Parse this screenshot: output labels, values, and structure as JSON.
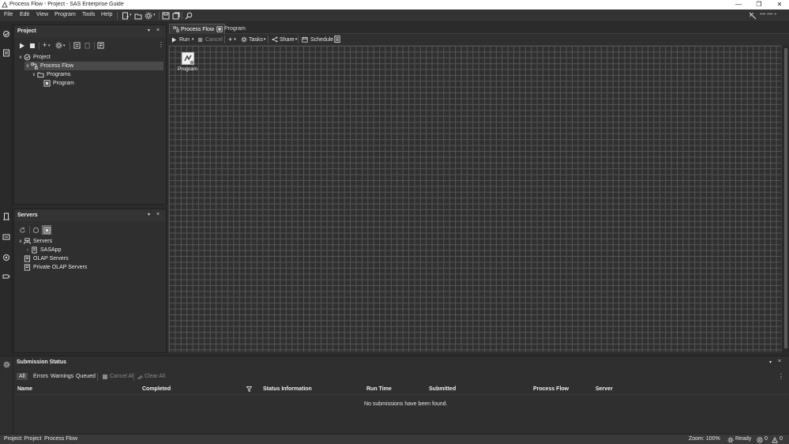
{
  "window": {
    "title": "Process Flow - Project - SAS Enterprise Guide",
    "minimize": "—",
    "restore": "❐",
    "close": "✕"
  },
  "menu": {
    "items": [
      "File",
      "Edit",
      "View",
      "Program",
      "Tools",
      "Help"
    ],
    "user": "••• ••• •"
  },
  "project_pane": {
    "title": "Project",
    "tree": {
      "root": "Project",
      "flow": "Process Flow",
      "folder": "Programs",
      "program": "Program"
    }
  },
  "servers_pane": {
    "title": "Servers",
    "tree": {
      "root": "Servers",
      "app": "SASApp",
      "olap": "OLAP Servers",
      "private_olap": "Private OLAP Servers"
    }
  },
  "workspace": {
    "tabs": [
      {
        "label": "Process Flow",
        "close": "×"
      },
      {
        "label": "Program"
      }
    ],
    "toolbar": {
      "run": "Run",
      "cancel": "Cancel",
      "add": "+",
      "tasks": "Tasks",
      "share": "Share",
      "schedule": "Schedule"
    },
    "node_label": "Program"
  },
  "submission_status": {
    "title": "Submission Status",
    "filters": [
      "All",
      "Errors",
      "Warnings",
      "Queued"
    ],
    "cancel_all": "Cancel All",
    "clear_all": "Clear All",
    "columns": [
      "Name",
      "Completed",
      "Status Information",
      "Run Time",
      "Submitted",
      "Process Flow",
      "Server"
    ],
    "empty_message": "No submissions have been found."
  },
  "statusbar": {
    "project": "Project: Project",
    "flow": "Process Flow",
    "zoom": "Zoom: 100%",
    "ready": "Ready",
    "errors": "0",
    "warnings": "0"
  },
  "colors": {
    "background": "#2b2b2b",
    "panel": "#2f2f2f",
    "grid_line": "#555555",
    "selection": "#4a4a4a"
  }
}
